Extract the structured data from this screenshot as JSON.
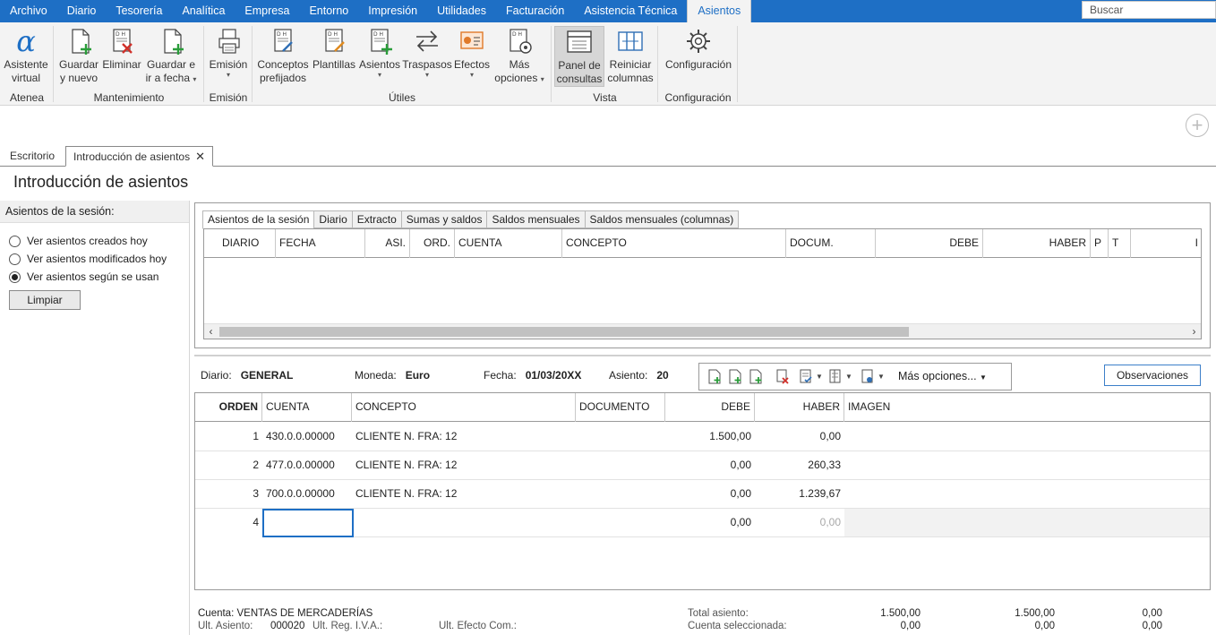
{
  "menu": {
    "tabs": [
      "Archivo",
      "Diario",
      "Tesorería",
      "Analítica",
      "Empresa",
      "Entorno",
      "Impresión",
      "Utilidades",
      "Facturación",
      "Asistencia Técnica",
      "Asientos"
    ],
    "active_tab": "Asientos",
    "search_placeholder": "Buscar"
  },
  "ribbon": {
    "groups": {
      "atenea": "Atenea",
      "mantenimiento": "Mantenimiento",
      "emision": "Emisión",
      "utiles": "Útiles",
      "vista": "Vista",
      "configuracion": "Configuración"
    },
    "buttons": {
      "asistente_l1": "Asistente",
      "asistente_l2": "virtual",
      "guardar_l1": "Guardar",
      "guardar_l2": "y nuevo",
      "eliminar": "Eliminar",
      "guardar_ir_l1": "Guardar e",
      "guardar_ir_l2": "ir a fecha",
      "emision": "Emisión",
      "conceptos_l1": "Conceptos",
      "conceptos_l2": "prefijados",
      "plantillas": "Plantillas",
      "asientos": "Asientos",
      "traspasos": "Traspasos",
      "efectos": "Efectos",
      "mas_l1": "Más",
      "mas_l2": "opciones",
      "panel_l1": "Panel de",
      "panel_l2": "consultas",
      "reiniciar_l1": "Reiniciar",
      "reiniciar_l2": "columnas",
      "configuracion": "Configuración"
    }
  },
  "doc_tabs": {
    "escritorio": "Escritorio",
    "introduccion": "Introducción de asientos"
  },
  "page_title": "Introducción de asientos",
  "left_panel": {
    "title": "Asientos de la sesión:",
    "options": [
      "Ver asientos creados hoy",
      "Ver asientos modificados hoy",
      "Ver asientos según se usan"
    ],
    "selected_index": 2,
    "clear_button": "Limpiar"
  },
  "session_tabs": [
    "Asientos de la sesión",
    "Diario",
    "Extracto",
    "Sumas y saldos",
    "Saldos mensuales",
    "Saldos mensuales (columnas)"
  ],
  "session_grid_columns": [
    "DIARIO",
    "FECHA",
    "ASI.",
    "ORD.",
    "CUENTA",
    "CONCEPTO",
    "DOCUM.",
    "DEBE",
    "HABER",
    "P",
    "T",
    "I"
  ],
  "entry_info": {
    "diario_label": "Diario:",
    "diario_value": "GENERAL",
    "moneda_label": "Moneda:",
    "moneda_value": "Euro",
    "fecha_label": "Fecha:",
    "fecha_value": "01/03/20XX",
    "asiento_label": "Asiento:",
    "asiento_value": "20",
    "mas_opciones": "Más opciones...",
    "observaciones": "Observaciones"
  },
  "entries": {
    "columns": [
      "ORDEN",
      "CUENTA",
      "CONCEPTO",
      "DOCUMENTO",
      "DEBE",
      "HABER",
      "IMAGEN"
    ],
    "rows": [
      {
        "orden": "1",
        "cuenta": "430.0.0.00000",
        "concepto": "CLIENTE N. FRA:  12",
        "documento": "",
        "debe": "1.500,00",
        "haber": "0,00"
      },
      {
        "orden": "2",
        "cuenta": "477.0.0.00000",
        "concepto": "CLIENTE N. FRA:  12",
        "documento": "",
        "debe": "0,00",
        "haber": "260,33"
      },
      {
        "orden": "3",
        "cuenta": "700.0.0.00000",
        "concepto": "CLIENTE N. FRA:  12",
        "documento": "",
        "debe": "0,00",
        "haber": "1.239,67"
      },
      {
        "orden": "4",
        "cuenta": "",
        "concepto": "",
        "documento": "",
        "debe": "0,00",
        "haber": "0,00"
      }
    ]
  },
  "footer": {
    "cuenta_label": "Cuenta:",
    "cuenta_value": "VENTAS DE MERCADERÍAS",
    "ult_asiento_label": "Ult. Asiento:",
    "ult_asiento_value": "000020",
    "ult_iva_label": "Ult. Reg. I.V.A.:",
    "ult_efecto_label": "Ult. Efecto Com.:",
    "total_label": "Total asiento:",
    "total_debe": "1.500,00",
    "total_haber": "1.500,00",
    "total_saldo": "0,00",
    "sel_label": "Cuenta seleccionada:",
    "sel_debe": "0,00",
    "sel_haber": "0,00",
    "sel_saldo": "0,00"
  }
}
